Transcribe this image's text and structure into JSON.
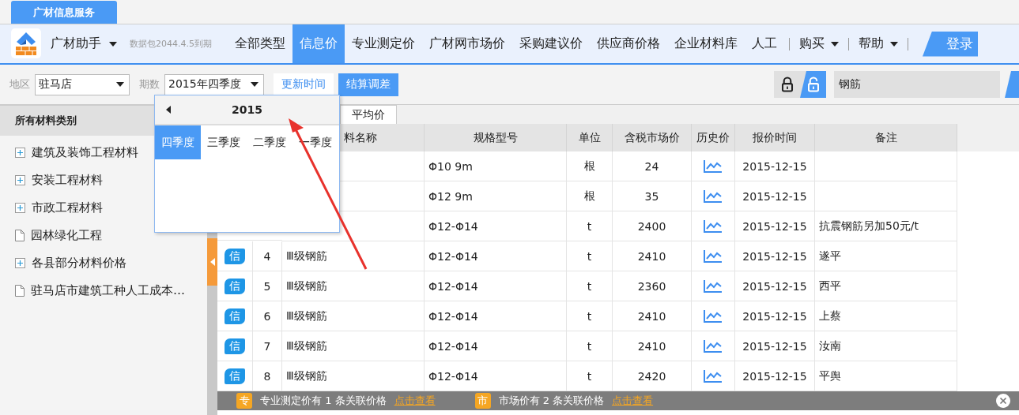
{
  "service_tab": {
    "label": "广材信息服务"
  },
  "app_menu": {
    "label": "广材助手"
  },
  "expiry": "数据包2044.4.5到期",
  "nav": [
    {
      "label": "全部类型",
      "selected": false
    },
    {
      "label": "信息价",
      "selected": true
    },
    {
      "label": "专业测定价",
      "selected": false
    },
    {
      "label": "广材网市场价",
      "selected": false
    },
    {
      "label": "采购建议价",
      "selected": false
    },
    {
      "label": "供应商价格",
      "selected": false
    },
    {
      "label": "企业材料库",
      "selected": false
    },
    {
      "label": "人工",
      "selected": false
    }
  ],
  "menus": [
    {
      "label": "购买"
    },
    {
      "label": "帮助"
    }
  ],
  "login": {
    "label": "登录"
  },
  "filters": {
    "region_label": "地区",
    "region": "驻马店",
    "period_label": "期数",
    "period": "2015年四季度"
  },
  "buttons": [
    {
      "label": "更新时间",
      "kind": "outline"
    },
    {
      "label": "结算调差",
      "kind": "primary"
    }
  ],
  "locks": [
    {
      "kind": "locked",
      "selected": false
    },
    {
      "kind": "unlocked",
      "selected": true
    }
  ],
  "search": {
    "value": "钢筋"
  },
  "sidebar": {
    "title": "所有材料类别",
    "items": [
      {
        "label": "建筑及装饰工程材料",
        "kind": "folder"
      },
      {
        "label": "安装工程材料",
        "kind": "folder"
      },
      {
        "label": "市政工程材料",
        "kind": "folder"
      },
      {
        "label": "园林绿化工程",
        "kind": "page"
      },
      {
        "label": "各县部分材料价格",
        "kind": "folder"
      },
      {
        "label": "驻马店市建筑工种人工成本…",
        "kind": "page"
      }
    ]
  },
  "tabs": [
    {
      "label": "平均价",
      "selected": true
    }
  ],
  "table": {
    "columns": [
      "料名称",
      "规格型号",
      "单位",
      "含税市场价",
      "历史价",
      "报价时间",
      "备注"
    ],
    "rows": [
      {
        "spec": "Φ10 9m",
        "unit": "根",
        "price": "24",
        "date": "2015-12-15"
      },
      {
        "spec": "Φ12 9m",
        "unit": "根",
        "price": "35",
        "date": "2015-12-15"
      },
      {
        "spec": "Φ12-Φ14",
        "unit": "t",
        "price": "2400",
        "date": "2015-12-15",
        "note": "抗震钢筋另加50元/t"
      },
      {
        "badge": "信",
        "index": "4",
        "name": "Ⅲ级钢筋",
        "spec": "Φ12-Φ14",
        "unit": "t",
        "price": "2410",
        "date": "2015-12-15",
        "note": "遂平"
      },
      {
        "badge": "信",
        "index": "5",
        "name": "Ⅲ级钢筋",
        "spec": "Φ12-Φ14",
        "unit": "t",
        "price": "2360",
        "date": "2015-12-15",
        "note": "西平"
      },
      {
        "badge": "信",
        "index": "6",
        "name": "Ⅲ级钢筋",
        "spec": "Φ12-Φ14",
        "unit": "t",
        "price": "2410",
        "date": "2015-12-15",
        "note": "上蔡"
      },
      {
        "badge": "信",
        "index": "7",
        "name": "Ⅲ级钢筋",
        "spec": "Φ12-Φ14",
        "unit": "t",
        "price": "2410",
        "date": "2015-12-15",
        "note": "汝南"
      },
      {
        "badge": "信",
        "index": "8",
        "name": "Ⅲ级钢筋",
        "spec": "Φ12-Φ14",
        "unit": "t",
        "price": "2420",
        "date": "2015-12-15",
        "note": "平舆"
      }
    ]
  },
  "period_picker": {
    "year": "2015",
    "quarters": [
      {
        "label": "四季度",
        "selected": true
      },
      {
        "label": "三季度",
        "selected": false
      },
      {
        "label": "二季度",
        "selected": false
      },
      {
        "label": "一季度",
        "selected": false
      }
    ]
  },
  "status_bar": {
    "items": [
      {
        "badge": "专",
        "text": "专业测定价有 1 条关联价格",
        "link": "点击查看"
      },
      {
        "badge": "市",
        "text": "市场价有 2 条关联价格",
        "link": "点击查看"
      }
    ]
  }
}
